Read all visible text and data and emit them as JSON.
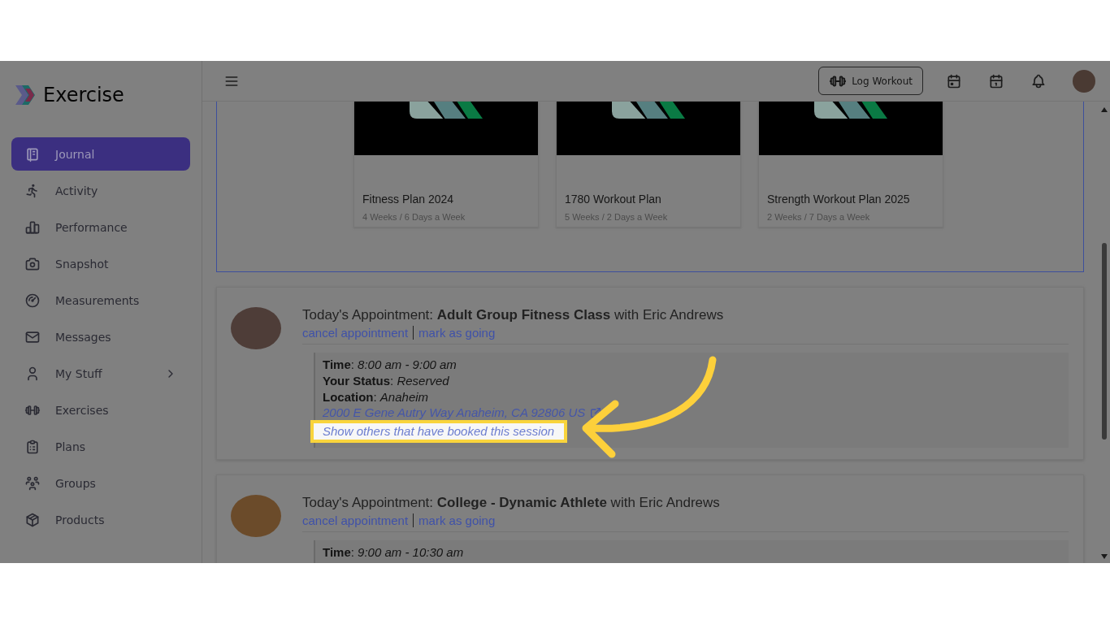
{
  "brand": {
    "name": "Exercise"
  },
  "sidebar": {
    "items": [
      {
        "label": "Journal",
        "selected": true,
        "expandable": false
      },
      {
        "label": "Activity",
        "selected": false,
        "expandable": false
      },
      {
        "label": "Performance",
        "selected": false,
        "expandable": false
      },
      {
        "label": "Snapshot",
        "selected": false,
        "expandable": false
      },
      {
        "label": "Measurements",
        "selected": false,
        "expandable": false
      },
      {
        "label": "Messages",
        "selected": false,
        "expandable": false
      },
      {
        "label": "My Stuff",
        "selected": false,
        "expandable": true
      },
      {
        "label": "Exercises",
        "selected": false,
        "expandable": false
      },
      {
        "label": "Plans",
        "selected": false,
        "expandable": false
      },
      {
        "label": "Groups",
        "selected": false,
        "expandable": false
      },
      {
        "label": "Products",
        "selected": false,
        "expandable": false
      }
    ]
  },
  "topbar": {
    "log_workout": "Log Workout"
  },
  "plans": [
    {
      "title": "Fitness Plan 2024",
      "subtitle": "4 Weeks / 6 Days a Week"
    },
    {
      "title": "1780 Workout Plan",
      "subtitle": "5 Weeks / 2 Days a Week"
    },
    {
      "title": "Strength Workout Plan 2025",
      "subtitle": "2 Weeks / 7 Days a Week"
    }
  ],
  "appointments": [
    {
      "heading": "Today's Appointment: **Adult Group Fitness Class** with Eric Andrews",
      "actions": [
        "cancel appointment",
        "mark as going"
      ],
      "details": [
        "**Time**: *8:00 am - 9:00 am*",
        "**Your Status**: *Reserved*",
        "**Location**: *Anaheim*"
      ],
      "address": "2000 E Gene Autry Way Anaheim, CA 92806 US",
      "others_link": "Show others that have booked this session",
      "highlighted": true
    },
    {
      "heading": "Today's Appointment: **College - Dynamic Athlete** with Eric Andrews",
      "actions": [
        "cancel appointment",
        "mark as going"
      ],
      "details": [
        "**Time**: *9:00 am - 10:30 am*"
      ]
    }
  ]
}
